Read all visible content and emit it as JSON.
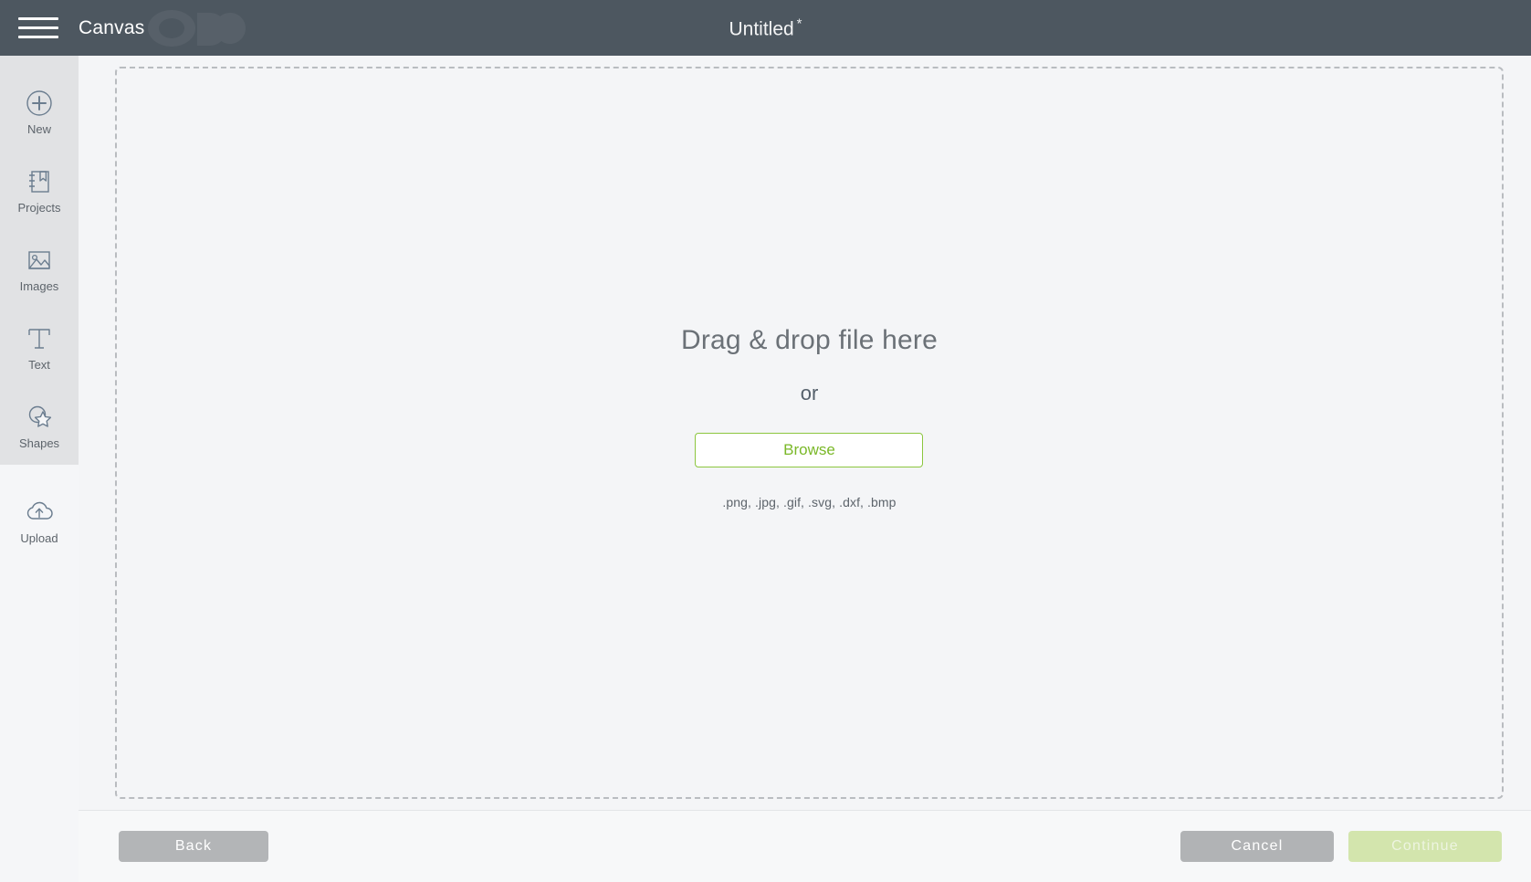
{
  "header": {
    "menu_icon": "hamburger-menu-icon",
    "app_name": "Canvas",
    "document_title": "Untitled",
    "unsaved_marker": "*"
  },
  "sidebar": {
    "items": [
      {
        "id": "new",
        "label": "New",
        "icon": "plus-circle-icon",
        "active": false
      },
      {
        "id": "projects",
        "label": "Projects",
        "icon": "notebook-bookmark-icon",
        "active": false
      },
      {
        "id": "images",
        "label": "Images",
        "icon": "picture-icon",
        "active": false
      },
      {
        "id": "text",
        "label": "Text",
        "icon": "text-t-icon",
        "active": false
      },
      {
        "id": "shapes",
        "label": "Shapes",
        "icon": "shapes-star-icon",
        "active": false
      },
      {
        "id": "upload",
        "label": "Upload",
        "icon": "cloud-upload-icon",
        "active": true
      }
    ]
  },
  "dropzone": {
    "title": "Drag & drop file here",
    "or": "or",
    "browse_label": "Browse",
    "formats": ".png, .jpg, .gif, .svg, .dxf, .bmp"
  },
  "footer": {
    "back_label": "Back",
    "cancel_label": "Cancel",
    "continue_label": "Continue"
  },
  "colors": {
    "header_bg": "#4d5760",
    "sidebar_bg": "#e1e2e4",
    "sidebar_active_bg": "#f5f6f8",
    "canvas_bg": "#f4f5f7",
    "accent_green": "#8cc63f",
    "accent_green_text": "#7ab828",
    "disabled_green": "#d3e5ad",
    "button_gray": "#b1b3b5",
    "dash_border": "#b9bcc0"
  }
}
